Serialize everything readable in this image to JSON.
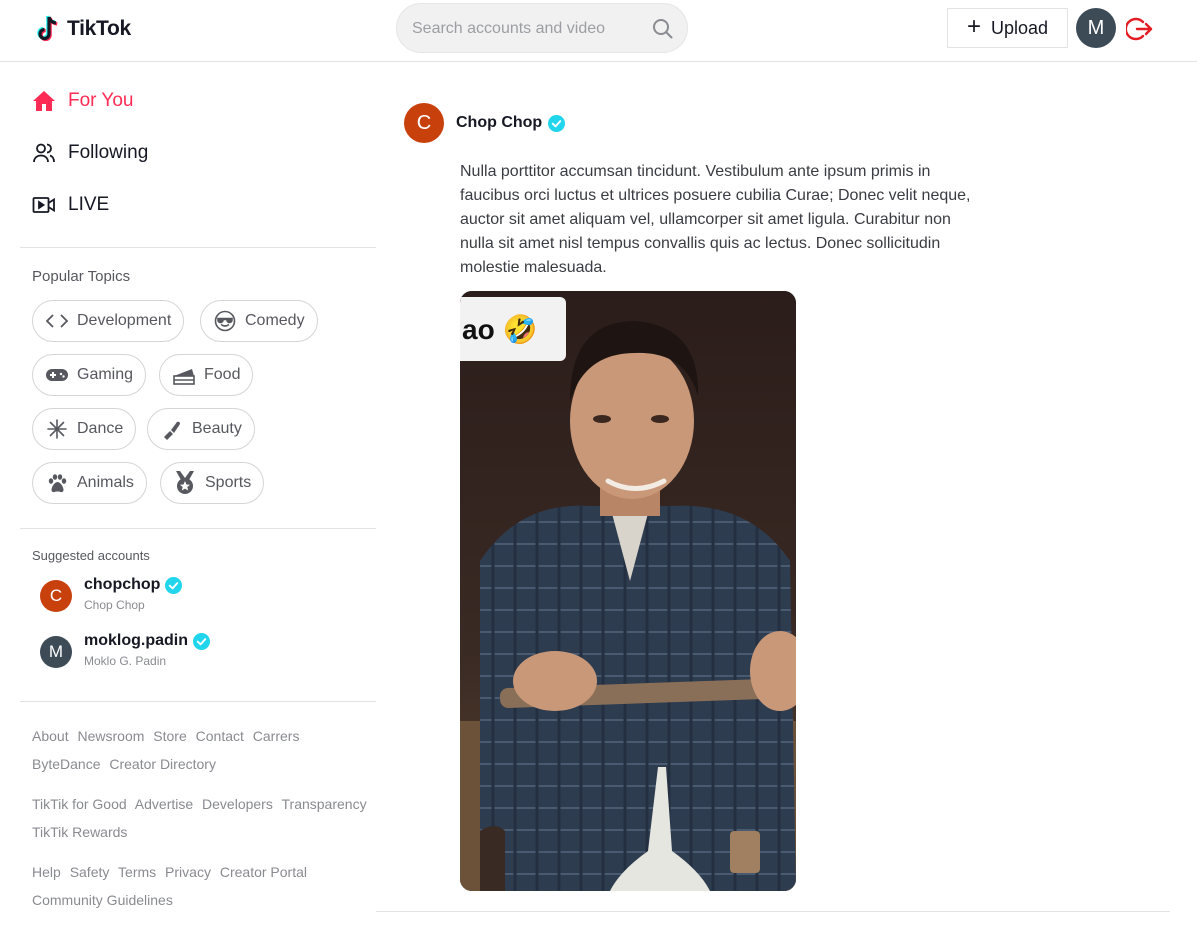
{
  "header": {
    "logo_text": "TikTok",
    "search_placeholder": "Search accounts and video",
    "upload_label": "Upload",
    "user_initial": "M"
  },
  "nav": {
    "items": [
      {
        "label": "For You",
        "icon": "home-icon",
        "active": true
      },
      {
        "label": "Following",
        "icon": "users-icon",
        "active": false
      },
      {
        "label": "LIVE",
        "icon": "live-icon",
        "active": false
      }
    ]
  },
  "topics": {
    "title": "Popular Topics",
    "items": [
      {
        "label": "Development",
        "icon": "code-icon"
      },
      {
        "label": "Comedy",
        "icon": "sunglasses-emoji-icon"
      },
      {
        "label": "Gaming",
        "icon": "gamepad-icon"
      },
      {
        "label": "Food",
        "icon": "cake-icon"
      },
      {
        "label": "Dance",
        "icon": "firework-icon"
      },
      {
        "label": "Beauty",
        "icon": "lipstick-icon"
      },
      {
        "label": "Animals",
        "icon": "paw-icon"
      },
      {
        "label": "Sports",
        "icon": "medal-icon"
      }
    ]
  },
  "suggested": {
    "title": "Suggested accounts",
    "accounts": [
      {
        "initial": "C",
        "username": "chopchop",
        "display_name": "Chop Chop",
        "color": "#c8410c"
      },
      {
        "initial": "M",
        "username": "moklog.padin",
        "display_name": "Moklo G. Padin",
        "color": "#3d4b57"
      }
    ]
  },
  "footer": {
    "group1": [
      "About",
      "Newsroom",
      "Store",
      "Contact",
      "Carrers",
      "ByteDance",
      "Creator Directory"
    ],
    "group2": [
      "TikTik for Good",
      "Advertise",
      "Developers",
      "Transparency",
      "TikTik Rewards"
    ],
    "group3": [
      "Help",
      "Safety",
      "Terms",
      "Privacy",
      "Creator Portal",
      "Community Guidelines"
    ]
  },
  "post": {
    "author_initial": "C",
    "author_name": "Chop Chop",
    "caption": "Nulla porttitor accumsan tincidunt. Vestibulum ante ipsum primis in faucibus orci luctus et ultrices posuere cubilia Curae; Donec velit neque, auctor sit amet aliquam vel, ullamcorper sit amet ligula. Curabitur non nulla sit amet nisl tempus convallis quis ac lectus. Donec sollicitudin molestie malesuada.",
    "video_overlay_text": "ao 🤣"
  },
  "colors": {
    "accent": "#fe2c55",
    "verified": "#20d5ec",
    "logout": "#e31b23"
  }
}
